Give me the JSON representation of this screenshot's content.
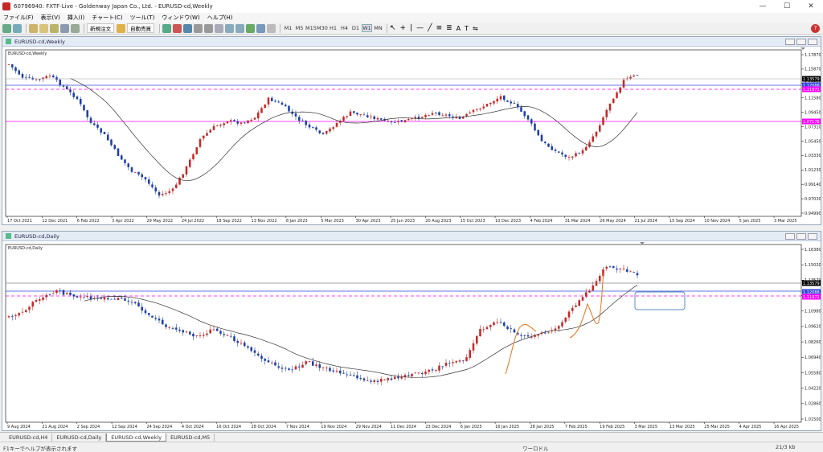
{
  "window": {
    "title": "60796940: FXTF-Live - Goldenway Japan Co., Ltd. - EURUSD-cd,Weekly",
    "minimize_icon": "minimize-icon",
    "maximize_icon": "maximize-icon",
    "close_icon": "close-icon"
  },
  "menu": [
    "ファイル(F)",
    "表示(V)",
    "挿入(I)",
    "チャート(C)",
    "ツール(T)",
    "ウィンドウ(W)",
    "ヘルプ(H)"
  ],
  "toolbar": {
    "new_order": "新規注文",
    "auto_trade": "自動売買",
    "timeframes": [
      "M1",
      "M5",
      "M15",
      "M30",
      "H1",
      "H4",
      "D1",
      "W1",
      "MN"
    ],
    "active_timeframe": "W1"
  },
  "weekly": {
    "window_title": "EURUSD-cd,Weekly",
    "inner_label": "EURUSD-cd,Weekly",
    "y_ticks": [
      "1.17870",
      "1.15870",
      "1.13590",
      "1.11580",
      "1.09450",
      "1.07310",
      "1.05450",
      "1.03330",
      "1.01230",
      "0.99140",
      "0.97030",
      "0.94990"
    ],
    "x_ticks": [
      "17 Oct 2021",
      "12 Dec 2021",
      "6 Feb 2022",
      "3 Apr 2022",
      "29 May 2022",
      "24 Jul 2022",
      "18 Sep 2022",
      "13 Nov 2022",
      "8 Jan 2023",
      "5 Mar 2023",
      "30 Apr 2023",
      "25 Jun 2023",
      "20 Aug 2023",
      "15 Oct 2023",
      "10 Dec 2023",
      "4 Feb 2024",
      "31 Mar 2024",
      "26 May 2024",
      "21 Jul 2024",
      "15 Sep 2024",
      "10 Nov 2024",
      "5 Jan 2025",
      "3 Mar 2025"
    ],
    "price_tag": "1.13579",
    "level_tags": [
      "1.12088",
      "1.11971",
      "1.07178"
    ]
  },
  "daily": {
    "window_title": "EURUSD-cd,Daily",
    "inner_label": "EURUSD-cd,Daily",
    "y_ticks": [
      "1.16380",
      "1.15020",
      "1.13579",
      "1.12088",
      "1.10980",
      "1.09620",
      "1.08260",
      "1.06940",
      "1.05580",
      "1.04220",
      "1.02860",
      "1.01500"
    ],
    "x_ticks": [
      "9 Aug 2024",
      "21 Aug 2024",
      "2 Sep 2024",
      "12 Sep 2024",
      "24 Sep 2024",
      "4 Oct 2024",
      "16 Oct 2024",
      "28 Oct 2024",
      "7 Nov 2024",
      "19 Nov 2024",
      "29 Nov 2024",
      "11 Dec 2024",
      "23 Dec 2024",
      "6 Jan 2025",
      "16 Jan 2025",
      "28 Jan 2025",
      "7 Feb 2025",
      "19 Feb 2025",
      "3 Mar 2025",
      "13 Mar 2025",
      "25 Mar 2025",
      "4 Apr 2025",
      "16 Apr 2025"
    ],
    "price_tag": "1.13579",
    "level_tags": [
      "1.12088",
      "1.11971"
    ]
  },
  "chart_tabs": [
    "EURUSD-cd,H4",
    "EURUSD-cd,Daily",
    "EURUSD-cd,Weekly",
    "EURUSD-cd,M5"
  ],
  "active_tab": "EURUSD-cd,Weekly",
  "status": {
    "help": "F1キーでヘルプが表示されます",
    "profile": "ワーロドル",
    "conn": "21/3 kb"
  },
  "colors": {
    "bull": "#c62828",
    "bear": "#1e3fa8",
    "ma": "#333333",
    "level_magenta": "#ff00ff",
    "level_blue": "#3344dd",
    "annotation": "#e8731b",
    "box": "#5a8fc0"
  }
}
